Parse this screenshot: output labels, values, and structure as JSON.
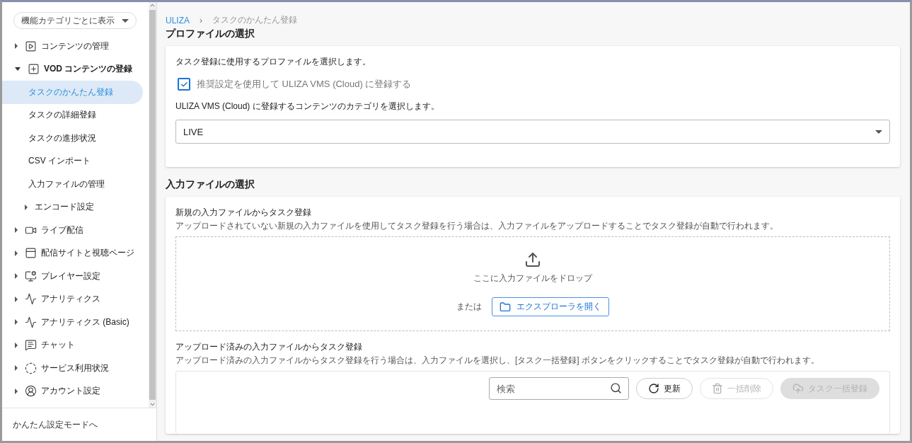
{
  "sidebar": {
    "view_selector": "機能カテゴリごとに表示",
    "items": [
      {
        "label": "コンテンツの管理",
        "expanded": false
      },
      {
        "label": "VOD コンテンツの登録",
        "expanded": true,
        "children": [
          {
            "label": "タスクのかんたん登録",
            "selected": true
          },
          {
            "label": "タスクの詳細登録",
            "selected": false
          },
          {
            "label": "タスクの進捗状況",
            "selected": false
          },
          {
            "label": "CSV インポート",
            "selected": false
          },
          {
            "label": "入力ファイルの管理",
            "selected": false
          },
          {
            "label": "エンコード設定",
            "selected": false,
            "expandable": true
          }
        ]
      },
      {
        "label": "ライブ配信",
        "expanded": false
      },
      {
        "label": "配信サイトと視聴ページ",
        "expanded": false
      },
      {
        "label": "プレイヤー設定",
        "expanded": false
      },
      {
        "label": "アナリティクス",
        "expanded": false
      },
      {
        "label": "アナリティクス (Basic)",
        "expanded": false
      },
      {
        "label": "チャット",
        "expanded": false
      },
      {
        "label": "サービス利用状況",
        "expanded": false
      },
      {
        "label": "アカウント設定",
        "expanded": false
      }
    ],
    "footer_link": "かんたん設定モードへ"
  },
  "breadcrumb": {
    "separator": "›",
    "items": [
      "ULIZA",
      "タスクのかんたん登録"
    ]
  },
  "profile_section": {
    "title": "プロファイルの選択",
    "description": "タスク登録に使用するプロファイルを選択します。",
    "checkbox": {
      "label": "推奨設定を使用して ULIZA VMS (Cloud) に登録する",
      "checked": true
    },
    "category_label": "ULIZA VMS (Cloud) に登録するコンテンツのカテゴリを選択します。",
    "category_select": {
      "value": "LIVE"
    }
  },
  "input_section": {
    "title": "入力ファイルの選択",
    "new_upload": {
      "title": "新規の入力ファイルからタスク登録",
      "description": "アップロードされていない新規の入力ファイルを使用してタスク登録を行う場合は、入力ファイルをアップロードすることでタスク登録が自動で行われます。",
      "drop_text": "ここに入力ファイルをドロップ",
      "or_text": "または",
      "browse_button": "エクスプローラを開く"
    },
    "uploaded": {
      "title": "アップロード済みの入力ファイルからタスク登録",
      "description": "アップロード済みの入力ファイルからタスク登録を行う場合は、入力ファイルを選択し、[タスク一括登録] ボタンをクリックすることでタスク登録が自動で行われます。",
      "search": {
        "placeholder": "検索"
      },
      "buttons": [
        {
          "label": "更新",
          "kind": "outline",
          "disabled": false
        },
        {
          "label": "一括削除",
          "kind": "outline",
          "disabled": true
        },
        {
          "label": "タスク一括登録",
          "kind": "filled",
          "disabled": true
        }
      ]
    }
  }
}
